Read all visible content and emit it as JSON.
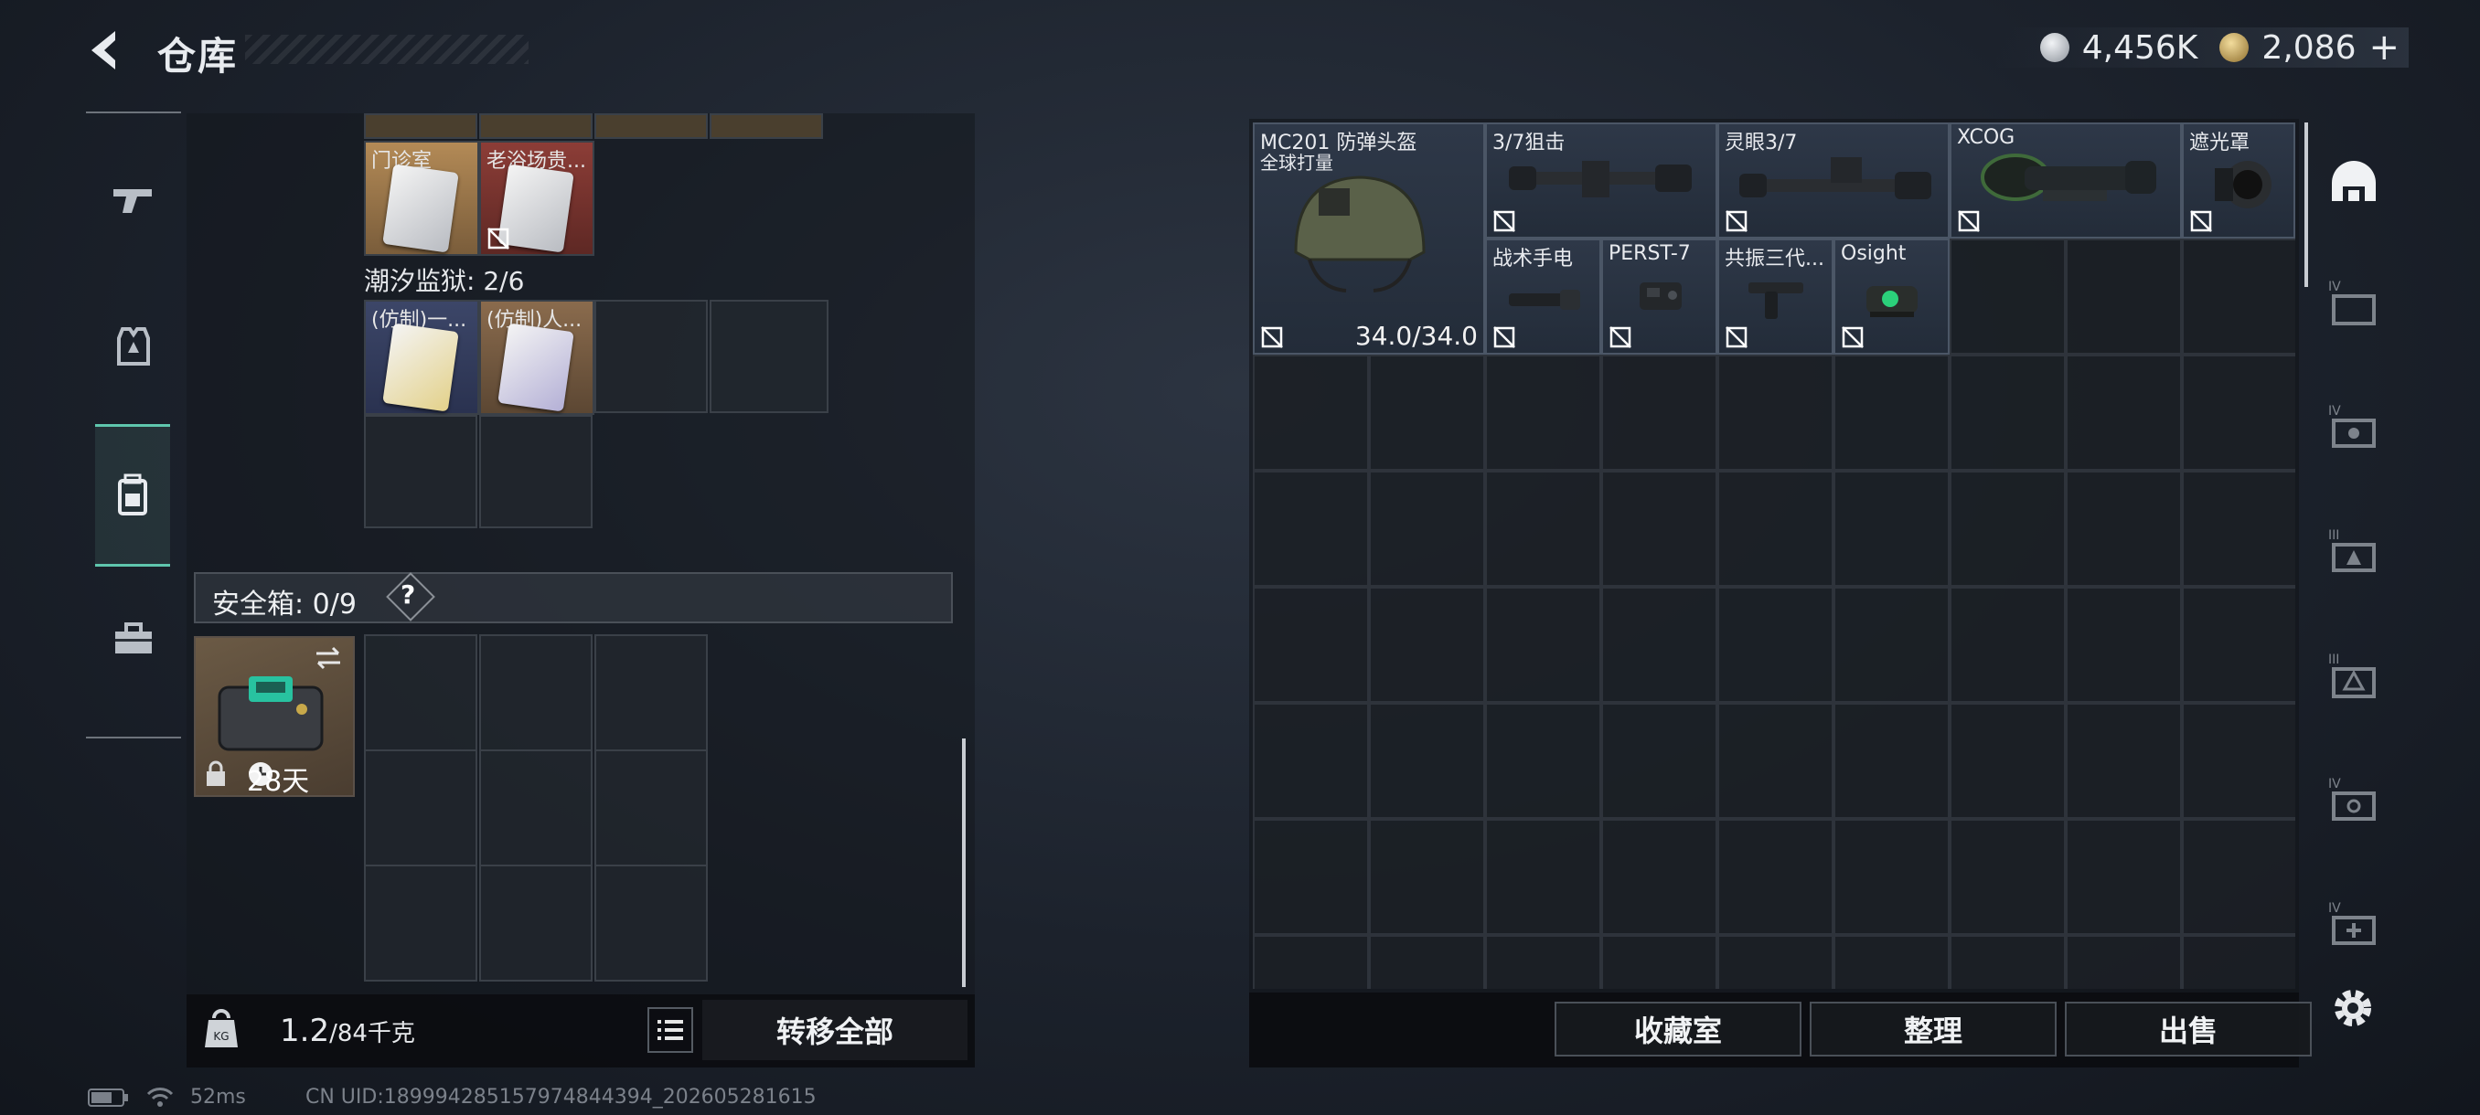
{
  "header": {
    "title": "仓库"
  },
  "currency": {
    "silver": "4,456K",
    "gold": "2,086",
    "plus": "+",
    "silver_color": "#c9ced6",
    "gold_color": "#c8a860"
  },
  "left_nav": {
    "items": [
      {
        "name": "weapon",
        "icon": "gun-icon"
      },
      {
        "name": "armor",
        "icon": "armor-vest-icon"
      },
      {
        "name": "backpack",
        "icon": "backpack-icon",
        "active": true
      },
      {
        "name": "toolbox",
        "icon": "toolbox-icon"
      }
    ]
  },
  "bag": {
    "key_items_top": [
      {
        "label": "门诊室",
        "color": "#c8a06a"
      },
      {
        "label": "老浴场贵...",
        "color": "#a0473f",
        "not_sellable": true
      }
    ],
    "prison_label": "潮汐监狱: 2/6",
    "prison_items": [
      {
        "label": "(仿制)一...",
        "color": "#3f4a6e"
      },
      {
        "label": "(仿制)人...",
        "color": "#8a6b4d"
      }
    ],
    "safe_label": "安全箱: 0/9",
    "safe_help": "?",
    "safe_days": "28天",
    "weight_value": "1.2",
    "weight_unit": "/84千克",
    "transfer_all": "转移全部"
  },
  "stash": {
    "items": [
      {
        "label": "MC201 防弹头盔",
        "sub": "全球打量",
        "durability": "34.0/34.0"
      },
      {
        "label": "3/7狙击"
      },
      {
        "label": "灵眼3/7"
      },
      {
        "label": "XCOG"
      },
      {
        "label": "遮光罩"
      },
      {
        "label": "战术手电"
      },
      {
        "label": "PERST-7"
      },
      {
        "label": "共振三代..."
      },
      {
        "label": "Osight"
      }
    ],
    "buttons": {
      "collection": "收藏室",
      "sort": "整理",
      "sell": "出售"
    }
  },
  "right_nav": {
    "items": [
      "helmet-icon",
      "container-iv-icon",
      "case-iv-icon",
      "case-iii-icon",
      "case-iii-b-icon",
      "case-iv-b-icon",
      "case-iv-plus-icon"
    ]
  },
  "status": {
    "ping": "52ms",
    "uid": "CN UID:1899942851579748443​94_202605281615"
  }
}
